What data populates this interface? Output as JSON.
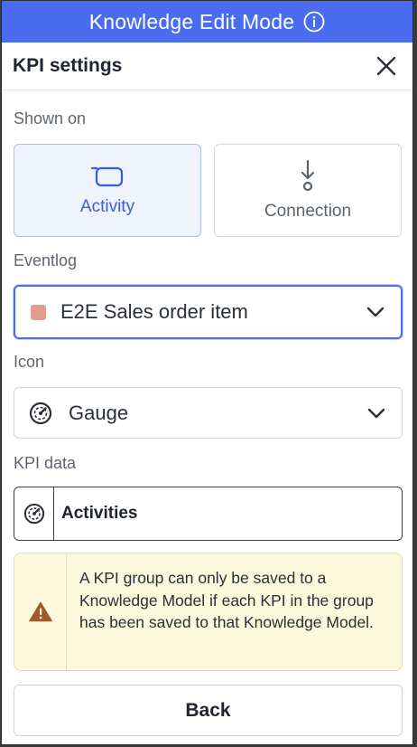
{
  "banner": {
    "title": "Knowledge Edit Mode"
  },
  "panel": {
    "title": "KPI settings"
  },
  "shown_on": {
    "label": "Shown on",
    "options": [
      {
        "label": "Activity",
        "selected": true
      },
      {
        "label": "Connection",
        "selected": false
      }
    ]
  },
  "eventlog": {
    "label": "Eventlog",
    "value": "E2E Sales order item",
    "swatch_color": "#e39b8c"
  },
  "icon_field": {
    "label": "Icon",
    "value": "Gauge"
  },
  "kpi_data": {
    "label": "KPI data",
    "value": "Activities"
  },
  "warning": {
    "text": "A KPI group can only be saved to a Knowledge Model if each KPI in the group has been saved to that Knowledge Model."
  },
  "footer": {
    "back_label": "Back"
  },
  "colors": {
    "accent": "#4a6cf0",
    "warning_bg": "#fef9dc",
    "warning_icon": "#a05a2c"
  }
}
